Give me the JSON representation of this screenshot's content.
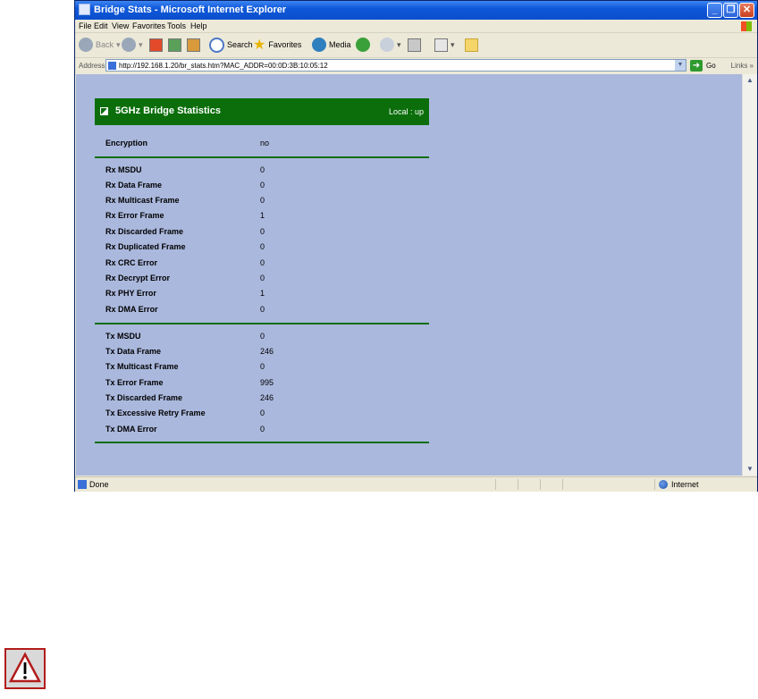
{
  "window": {
    "title": "Bridge Stats - Microsoft Internet Explorer"
  },
  "menu": [
    "File",
    "Edit",
    "View",
    "Favorites",
    "Tools",
    "Help"
  ],
  "toolbar": {
    "back": "Back",
    "search": "Search",
    "favorites": "Favorites",
    "media": "Media"
  },
  "address": {
    "label": "Address",
    "url": "http://192.168.1.20/br_stats.htm?MAC_ADDR=00:0D:3B:10:05:12",
    "go": "Go",
    "links": "Links"
  },
  "panel": {
    "title": "5GHz Bridge Statistics",
    "status": "Local : up",
    "encryption": {
      "label": "Encryption",
      "value": "no"
    },
    "rx": [
      {
        "label": "Rx MSDU",
        "value": "0"
      },
      {
        "label": "Rx Data Frame",
        "value": "0"
      },
      {
        "label": "Rx Multicast Frame",
        "value": "0"
      },
      {
        "label": "Rx Error Frame",
        "value": "1"
      },
      {
        "label": "Rx Discarded Frame",
        "value": "0"
      },
      {
        "label": "Rx Duplicated Frame",
        "value": "0"
      },
      {
        "label": "Rx CRC Error",
        "value": "0"
      },
      {
        "label": "Rx Decrypt Error",
        "value": "0"
      },
      {
        "label": "Rx PHY Error",
        "value": "1"
      },
      {
        "label": "Rx DMA Error",
        "value": "0"
      }
    ],
    "tx": [
      {
        "label": "Tx MSDU",
        "value": "0"
      },
      {
        "label": "Tx Data Frame",
        "value": "246"
      },
      {
        "label": "Tx Multicast Frame",
        "value": "0"
      },
      {
        "label": "Tx Error Frame",
        "value": "995"
      },
      {
        "label": "Tx Discarded Frame",
        "value": "246"
      },
      {
        "label": "Tx Excessive Retry Frame",
        "value": "0"
      },
      {
        "label": "Tx DMA Error",
        "value": "0"
      }
    ]
  },
  "status": {
    "text": "Done",
    "zone": "Internet"
  },
  "colors": {
    "header_green": "#0b6e0b",
    "page_bg": "#aab8dd"
  },
  "icons": {
    "warning": "warning-triangle-icon"
  }
}
